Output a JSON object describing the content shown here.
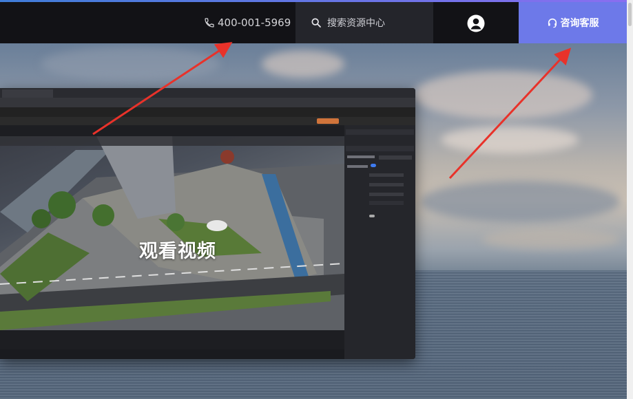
{
  "header": {
    "phone": "400-001-5969",
    "search_placeholder": "搜索资源中心",
    "consult_label": "咨询客服"
  },
  "video": {
    "watch_label": "观看视频"
  },
  "colors": {
    "header_bg": "#121216",
    "search_bg": "#24252b",
    "consult_bg": "#6d79e9",
    "arrow": "#e8322a"
  },
  "icons": {
    "phone": "phone-icon",
    "search": "search-icon",
    "user": "user-avatar-icon",
    "service": "headset-icon"
  }
}
